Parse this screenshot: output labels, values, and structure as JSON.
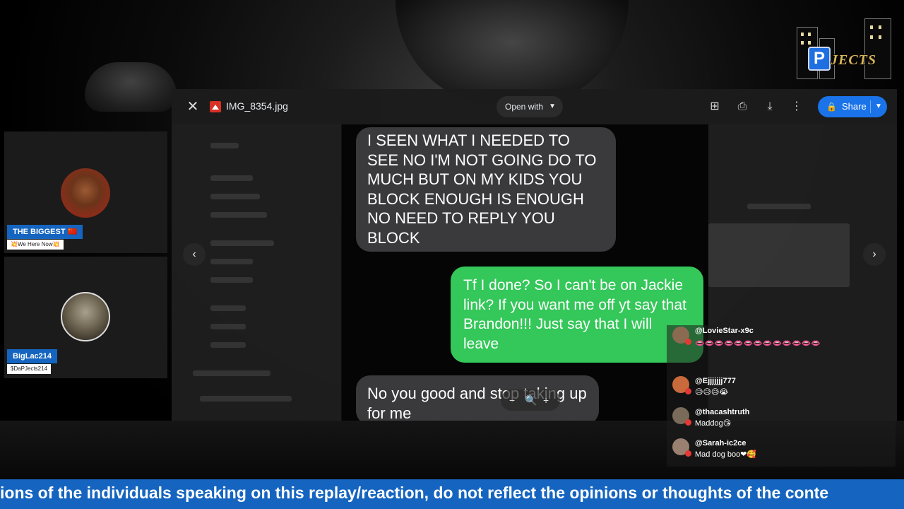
{
  "viewer": {
    "file_name": "IMG_8354.jpg",
    "open_with": "Open with",
    "share": "Share",
    "icons": [
      "close-icon",
      "add-to-drive-icon",
      "print-icon",
      "download-icon",
      "more-vert-icon",
      "lock-icon",
      "chevron-left-icon",
      "chevron-right-icon",
      "zoom-icon"
    ]
  },
  "screenshot": {
    "message_1": "I SEEN WHAT I NEEDED TO SEE NO I'M NOT GOING DO TO MUCH BUT ON MY KIDS YOU BLOCK ENOUGH IS ENOUGH NO NEED TO REPLY YOU BLOCK",
    "message_2": "Tf I done? So I can't be on Jackie link? If you want me off yt say that Brandon!!! Just say that I will leave",
    "message_3": "No you good and stop taking up for me"
  },
  "cams": [
    {
      "name": "THE BIGGEST 🇨🇳",
      "tag": "💥We Here Now💥"
    },
    {
      "name": "BigLac214",
      "tag": "$DaPJects214"
    }
  ],
  "chat": [
    {
      "user": "@LovieStar-x9c",
      "text": "👄👄👄👄👄👄👄👄👄👄👄👄👄"
    },
    {
      "user": "@Ejjjjjjj777",
      "text": "😥😥😥😭"
    },
    {
      "user": "@thacashtruth",
      "text": "Maddog😘"
    },
    {
      "user": "@Sarah-ic2ce",
      "text": "Mad dog boo❤🥰"
    }
  ],
  "logo": {
    "letter": "P",
    "word": "JECTS"
  },
  "ticker": "ions of the individuals speaking on this replay/reaction, do not reflect the opinions or thoughts of the conte",
  "colors": {
    "share": "#1a73e8",
    "imessage_green": "#34c759",
    "ticker": "#1565c0",
    "cam_label": "#1565c0"
  }
}
